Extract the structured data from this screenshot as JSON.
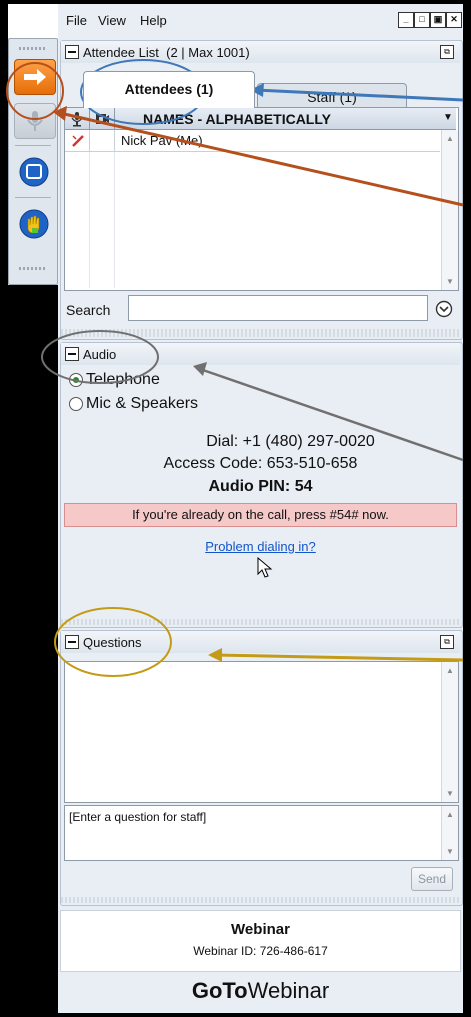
{
  "menu": {
    "file": "File",
    "view": "View",
    "help": "Help"
  },
  "window_buttons": {
    "minimize": "_",
    "restore": "□",
    "maximize": "▣",
    "close": "✕"
  },
  "attendee_panel": {
    "title": "Attendee List",
    "count": "(2 | Max 1001)",
    "tabs": [
      {
        "label": "Attendees (1)"
      },
      {
        "label": "Staff (1)"
      }
    ],
    "column_header": "NAMES - ALPHABETICALLY",
    "rows": [
      {
        "name": "Nick Pav (Me)"
      }
    ],
    "search_label": "Search",
    "search_value": ""
  },
  "audio_panel": {
    "title": "Audio",
    "options": [
      {
        "label": "Telephone",
        "selected": true
      },
      {
        "label": "Mic & Speakers",
        "selected": false
      }
    ],
    "dial": "Dial: +1 (480) 297-0020",
    "access_code": "Access Code: 653-510-658",
    "audio_pin": "Audio PIN: 54",
    "notice": "If you're already on the call, press #54# now.",
    "problem_link": "Problem dialing in?"
  },
  "questions_panel": {
    "title": "Questions",
    "input_placeholder": "[Enter a question for staff]",
    "send_label": "Send"
  },
  "footer": {
    "title": "Webinar",
    "webinar_id": "Webinar ID: 726-486-617",
    "brand_bold": "GoTo",
    "brand_regular": "Webinar"
  },
  "colors": {
    "accent_orange": "#f07b1a",
    "annotation_blue": "#3e78b9",
    "annotation_orange": "#b5501c",
    "annotation_gray": "#707070",
    "annotation_gold": "#c49b16",
    "notice_bg": "#f6c9c9",
    "link": "#1155cc"
  },
  "icons": {
    "toolbar": [
      "arrow-right-icon",
      "microphone-icon",
      "screen-icon",
      "raise-hand-icon"
    ],
    "grid_header": [
      "microphone-icon",
      "webcam-icon"
    ]
  }
}
